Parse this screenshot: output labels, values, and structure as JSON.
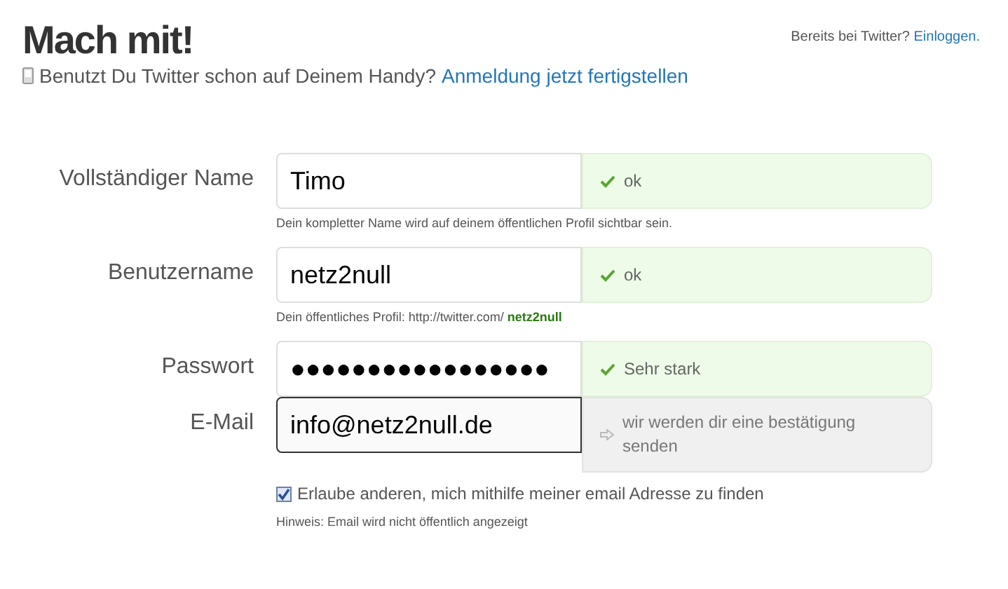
{
  "header": {
    "title": "Mach mit!",
    "subtitle": "Benutzt Du Twitter schon auf Deinem Handy?",
    "subtitle_link": "Anmeldung jetzt fertigstellen",
    "login_prompt": "Bereits bei Twitter?",
    "login_link": "Einloggen."
  },
  "fields": [
    {
      "label": "Vollständiger Name",
      "value": "Timo",
      "focused": false,
      "status": {
        "kind": "valid",
        "text": "ok"
      },
      "hint": "Dein kompletter Name wird auf deinem öffentlichen Profil sichtbar sein."
    },
    {
      "label": "Benutzername",
      "value": "netz2null",
      "focused": false,
      "status": {
        "kind": "valid",
        "text": "ok"
      },
      "hint": "Dein öffentliches Profil: http://twitter.com/ **netz2null**"
    },
    {
      "label": "Passwort",
      "value": "●●●●●●●●●●●●●●●●●",
      "focused": false,
      "status": {
        "kind": "valid",
        "text": "Sehr stark"
      }
    },
    {
      "label": "E-Mail",
      "value": "info@netz2null.de",
      "focused": true,
      "status": {
        "kind": "info",
        "text": "wir werden dir eine bestätigung senden"
      }
    }
  ],
  "checkbox": {
    "label": "Erlaube anderen, mich mithilfe meiner email Adresse zu finden",
    "checked": true
  },
  "note": "Hinweis: Email wird nicht öffentlich angezeigt"
}
